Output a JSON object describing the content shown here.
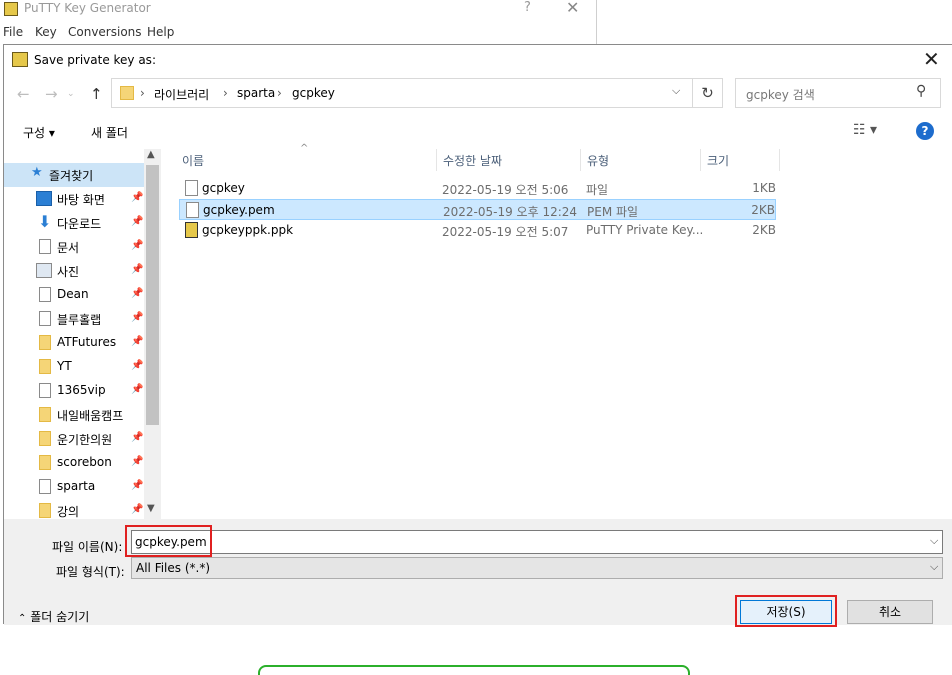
{
  "background_window": {
    "title": "PuTTY Key Generator",
    "help": "?",
    "close": "✕",
    "menu": [
      "File",
      "Key",
      "Conversions",
      "Help"
    ]
  },
  "dialog": {
    "title": "Save private key as:",
    "close": "✕"
  },
  "address": {
    "crumbs": [
      "라이브러리",
      "sparta",
      "gcpkey"
    ],
    "search_placeholder": "gcpkey 검색"
  },
  "toolbar": {
    "organize": "구성 ▾",
    "new_folder": "새 폴더",
    "help": "?"
  },
  "nav": {
    "favorites": "즐겨찾기",
    "items": [
      {
        "label": "바탕 화면",
        "icon": "desktop-icon"
      },
      {
        "label": "다운로드",
        "icon": "download-icon"
      },
      {
        "label": "문서",
        "icon": "document-icon"
      },
      {
        "label": "사진",
        "icon": "pictures-icon"
      },
      {
        "label": "Dean",
        "icon": "file-icon"
      },
      {
        "label": "블루홀랩",
        "icon": "file-icon"
      },
      {
        "label": "ATFutures",
        "icon": "folder-icon"
      },
      {
        "label": "YT",
        "icon": "folder-icon"
      },
      {
        "label": "1365vip",
        "icon": "file-icon"
      },
      {
        "label": "내일배움캠프",
        "icon": "folder-icon"
      },
      {
        "label": "운기한의원",
        "icon": "folder-icon"
      },
      {
        "label": "scorebon",
        "icon": "folder-icon"
      },
      {
        "label": "sparta",
        "icon": "file-icon"
      },
      {
        "label": "강의",
        "icon": "folder-icon"
      }
    ]
  },
  "columns": {
    "name": "이름",
    "date": "수정한 날짜",
    "type": "유형",
    "size": "크기"
  },
  "files": [
    {
      "name": "gcpkey",
      "date": "2022-05-19 오전 5:06",
      "type": "파일",
      "size": "1KB"
    },
    {
      "name": "gcpkey.pem",
      "date": "2022-05-19 오후 12:24",
      "type": "PEM 파일",
      "size": "2KB"
    },
    {
      "name": "gcpkeyppk.ppk",
      "date": "2022-05-19 오전 5:07",
      "type": "PuTTY Private Key...",
      "size": "2KB"
    }
  ],
  "filename": {
    "label": "파일 이름(N):",
    "value": "gcpkey.pem"
  },
  "filetype": {
    "label": "파일 형식(T):",
    "value": "All Files (*.*)"
  },
  "hide_folders": "폴더 숨기기",
  "buttons": {
    "save": "저장(S)",
    "cancel": "취소"
  }
}
